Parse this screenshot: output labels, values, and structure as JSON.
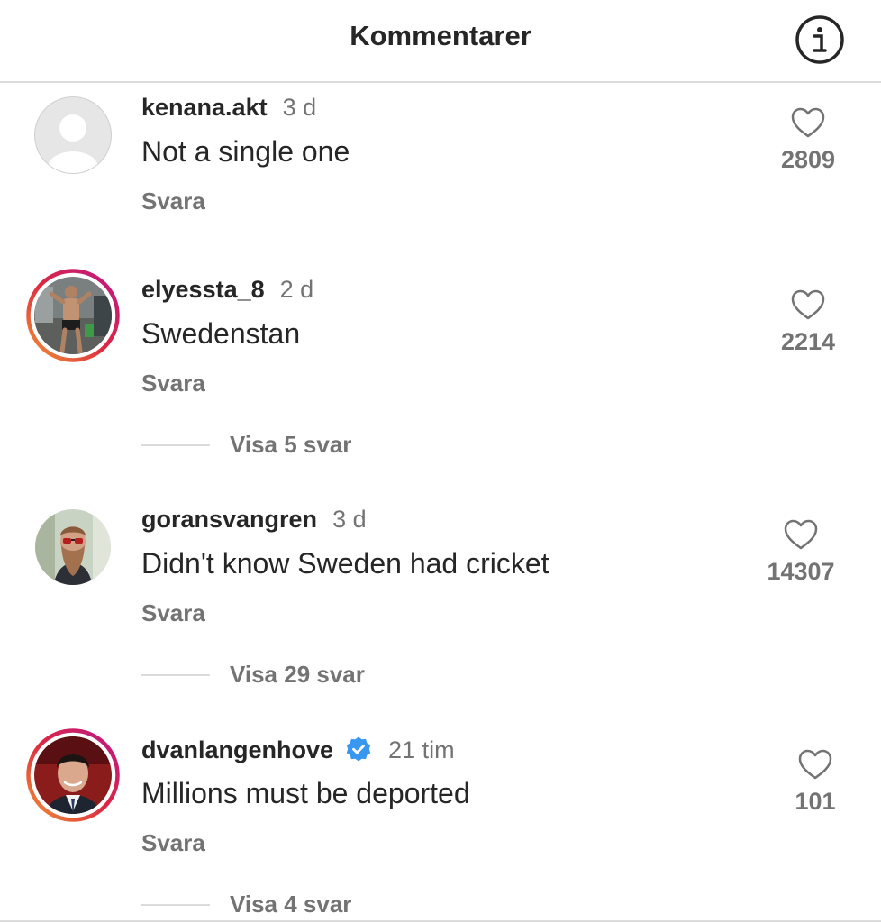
{
  "header": {
    "title": "Kommentarer",
    "info_icon": "info-icon"
  },
  "comments": [
    {
      "username": "kenana.akt",
      "time": "3 d",
      "text": "Not a single one",
      "reply_label": "Svara",
      "likes": "2809",
      "avatar": "default-avatar-icon",
      "story_ring": false,
      "verified": false
    },
    {
      "username": "elyessta_8",
      "time": "2 d",
      "text": "Swedenstan",
      "reply_label": "Svara",
      "likes": "2214",
      "view_replies": "Visa 5 svar",
      "avatar": "profile-photo",
      "story_ring": true,
      "verified": false
    },
    {
      "username": "goransvangren",
      "time": "3 d",
      "text": "Didn't know Sweden had cricket",
      "reply_label": "Svara",
      "likes": "14307",
      "view_replies": "Visa 29 svar",
      "avatar": "profile-photo",
      "story_ring": false,
      "verified": false
    },
    {
      "username": "dvanlangenhove",
      "time": "21 tim",
      "text": "Millions must be deported",
      "reply_label": "Svara",
      "likes": "101",
      "view_replies": "Visa 4 svar",
      "avatar": "profile-photo",
      "story_ring": true,
      "verified": true
    }
  ],
  "colors": {
    "text": "#262626",
    "secondary": "#737373",
    "divider": "#dbdbdb",
    "verified": "#3897f0",
    "ring_start": "#f09433",
    "ring_end": "#bc1888"
  }
}
